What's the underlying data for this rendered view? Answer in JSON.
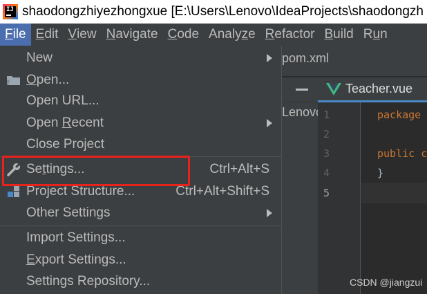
{
  "titlebar": {
    "logo_text": "IJ",
    "title": "shaodongzhiyezhongxue [E:\\Users\\Lenovo\\IdeaProjects\\shaodongzh"
  },
  "menubar": {
    "items": [
      {
        "label": "File",
        "active": true
      },
      {
        "label": "Edit"
      },
      {
        "label": "View"
      },
      {
        "label": "Navigate"
      },
      {
        "label": "Code"
      },
      {
        "label": "Analyze"
      },
      {
        "label": "Refactor"
      },
      {
        "label": "Build"
      },
      {
        "label": "Run"
      }
    ]
  },
  "background": {
    "file_tab": "pom.xml",
    "project_text": "Lenovo",
    "editor_tab": "Teacher.vue",
    "line_numbers": [
      "1",
      "2",
      "3",
      "4",
      "5"
    ],
    "code_lines": [
      "package",
      "",
      "public c",
      "}",
      ""
    ]
  },
  "file_menu": {
    "items": [
      {
        "label": "New",
        "submenu": true
      },
      {
        "label": "Open...",
        "icon": "folder-icon"
      },
      {
        "label": "Open URL..."
      },
      {
        "label": "Open Recent",
        "submenu": true
      },
      {
        "label": "Close Project"
      },
      {
        "label": "Settings...",
        "shortcut": "Ctrl+Alt+S",
        "icon": "wrench-icon"
      },
      {
        "label": "Project Structure...",
        "shortcut": "Ctrl+Alt+Shift+S",
        "icon": "project-structure-icon"
      },
      {
        "label": "Other Settings",
        "submenu": true
      },
      {
        "label": "Import Settings..."
      },
      {
        "label": "Export Settings..."
      },
      {
        "label": "Settings Repository..."
      }
    ]
  },
  "highlight_color": "#e8231c",
  "watermark": "CSDN @jiangzui"
}
